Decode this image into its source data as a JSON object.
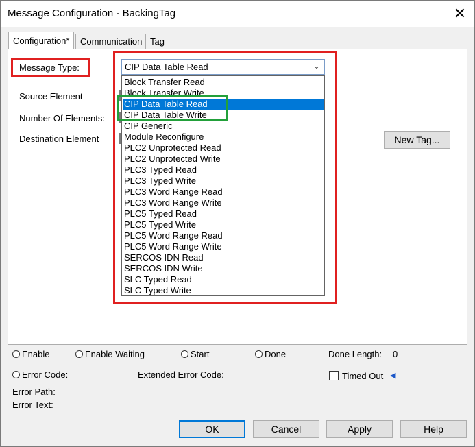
{
  "window": {
    "title": "Message Configuration - BackingTag",
    "close_glyph": "✕"
  },
  "tabs": [
    {
      "label": "Configuration*",
      "active": true
    },
    {
      "label": "Communication",
      "active": false
    },
    {
      "label": "Tag",
      "active": false
    }
  ],
  "config": {
    "message_type_label": "Message Type:",
    "source_element_label": "Source Element",
    "number_of_elements_label": "Number Of Elements:",
    "destination_element_label": "Destination Element",
    "new_tag_button": "New Tag...",
    "message_type_value": "CIP Data Table Read",
    "dropdown_options": [
      "Block Transfer Read",
      "Block Transfer Write",
      "CIP Data Table Read",
      "CIP Data Table Write",
      "CIP Generic",
      "Module Reconfigure",
      "PLC2 Unprotected Read",
      "PLC2 Unprotected Write",
      "PLC3 Typed Read",
      "PLC3 Typed Write",
      "PLC3 Word Range Read",
      "PLC3 Word Range Write",
      "PLC5 Typed Read",
      "PLC5 Typed Write",
      "PLC5 Word Range Read",
      "PLC5 Word Range Write",
      "SERCOS IDN Read",
      "SERCOS IDN Write",
      "SLC Typed Read",
      "SLC Typed Write"
    ],
    "selected_option": "CIP Data Table Read"
  },
  "status": {
    "enable": "Enable",
    "enable_waiting": "Enable Waiting",
    "start": "Start",
    "done": "Done",
    "done_length_label": "Done Length:",
    "done_length_value": "0",
    "error_code_label": "Error Code:",
    "extended_error_code_label": "Extended Error Code:",
    "timed_out_label": "Timed Out",
    "error_path_label": "Error Path:",
    "error_text_label": "Error Text:"
  },
  "buttons": {
    "ok": "OK",
    "cancel": "Cancel",
    "apply": "Apply",
    "help": "Help"
  },
  "colors": {
    "highlight_red": "#e02020",
    "highlight_green": "#22a03a",
    "selection_blue": "#0078d7"
  }
}
